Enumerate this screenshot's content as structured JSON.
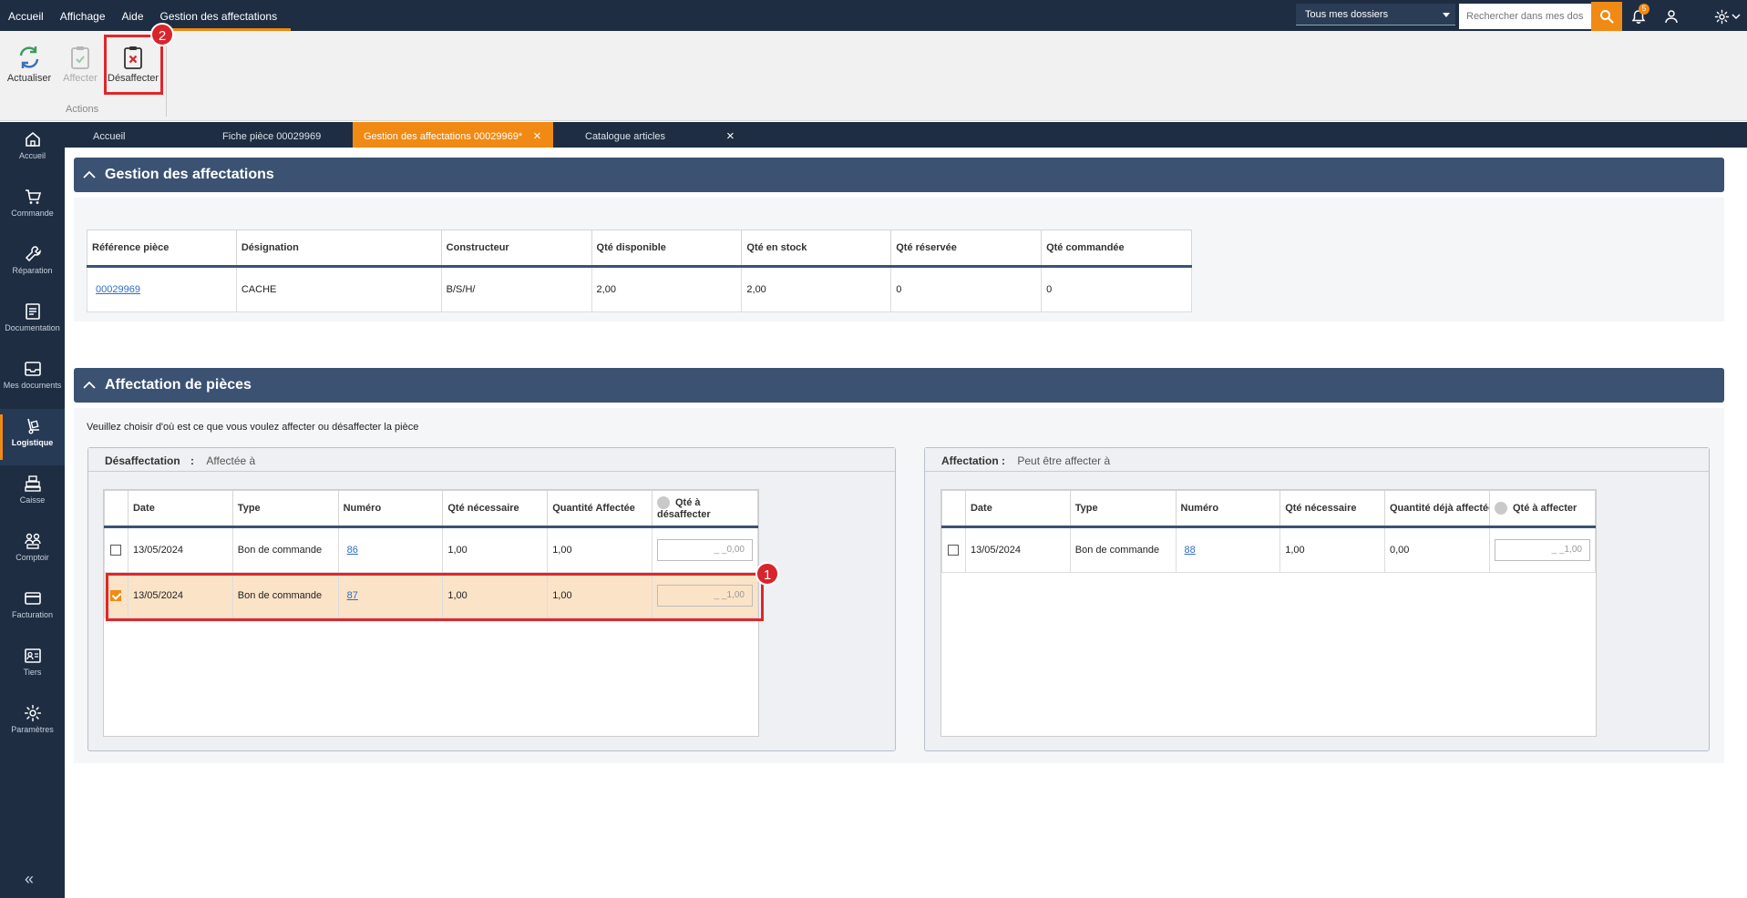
{
  "menubar": {
    "items": [
      "Accueil",
      "Affichage",
      "Aide",
      "Gestion des affectations"
    ]
  },
  "topbar": {
    "dossier_select": "Tous mes dossiers",
    "search_placeholder": "Rechercher dans mes dossiers",
    "notification_count": "5"
  },
  "ribbon": {
    "buttons": {
      "actualiser": "Actualiser",
      "affecter": "Affecter",
      "desaffecter": "Désaffecter"
    },
    "group_label": "Actions",
    "callout_2": "2"
  },
  "sidebar": {
    "items": [
      "Accueil",
      "Commande",
      "Réparation",
      "Documentation",
      "Mes documents",
      "Logistique",
      "Caisse",
      "Comptoir",
      "Facturation",
      "Tiers",
      "Paramètres"
    ],
    "collapse": "«"
  },
  "tabs": [
    {
      "label": "Accueil"
    },
    {
      "label": "Fiche pièce 00029969"
    },
    {
      "label": "Gestion des affectations 00029969*"
    },
    {
      "label": "Catalogue articles"
    }
  ],
  "gestion": {
    "title": "Gestion des affectations",
    "columns": [
      "Référence pièce",
      "Désignation",
      "Constructeur",
      "Qté disponible",
      "Qté en stock",
      "Qté réservée",
      "Qté commandée"
    ],
    "row": {
      "ref": "00029969",
      "designation": "CACHE",
      "constructeur": "B/S/H/",
      "qte_disponible": "2,00",
      "qte_stock": "2,00",
      "qte_reservee": "0",
      "qte_commandee": "0"
    }
  },
  "affectation": {
    "title": "Affectation de pièces",
    "instruction": "Veuillez choisir d'où est ce que vous voulez affecter ou désaffecter la pièce",
    "desaffectation": {
      "legend_label": "Désaffectation",
      "legend_sep": ":",
      "legend_value": "Affectée à",
      "columns": [
        "Date",
        "Type",
        "Numéro",
        "Qté nécessaire",
        "Quantité Affectée",
        "Qté à désaffecter"
      ],
      "rows": [
        {
          "date": "13/05/2024",
          "type": "Bon de commande",
          "numero": "86",
          "qte_necessaire": "1,00",
          "qte_affectee": "1,00",
          "qte": "_ _0,00",
          "checked": false
        },
        {
          "date": "13/05/2024",
          "type": "Bon de commande",
          "numero": "87",
          "qte_necessaire": "1,00",
          "qte_affectee": "1,00",
          "qte": "_ _1,00",
          "checked": true
        }
      ],
      "callout_1": "1"
    },
    "affecter": {
      "legend_label": "Affectation :",
      "legend_value": "Peut être affecter à",
      "columns": [
        "Date",
        "Type",
        "Numéro",
        "Qté nécessaire",
        "Quantité déjà affectée",
        "Qté à affecter"
      ],
      "rows": [
        {
          "date": "13/05/2024",
          "type": "Bon de commande",
          "numero": "88",
          "qte_necessaire": "1,00",
          "qte_deja": "0,00",
          "qte": "_ _1,00",
          "checked": false
        }
      ]
    }
  }
}
